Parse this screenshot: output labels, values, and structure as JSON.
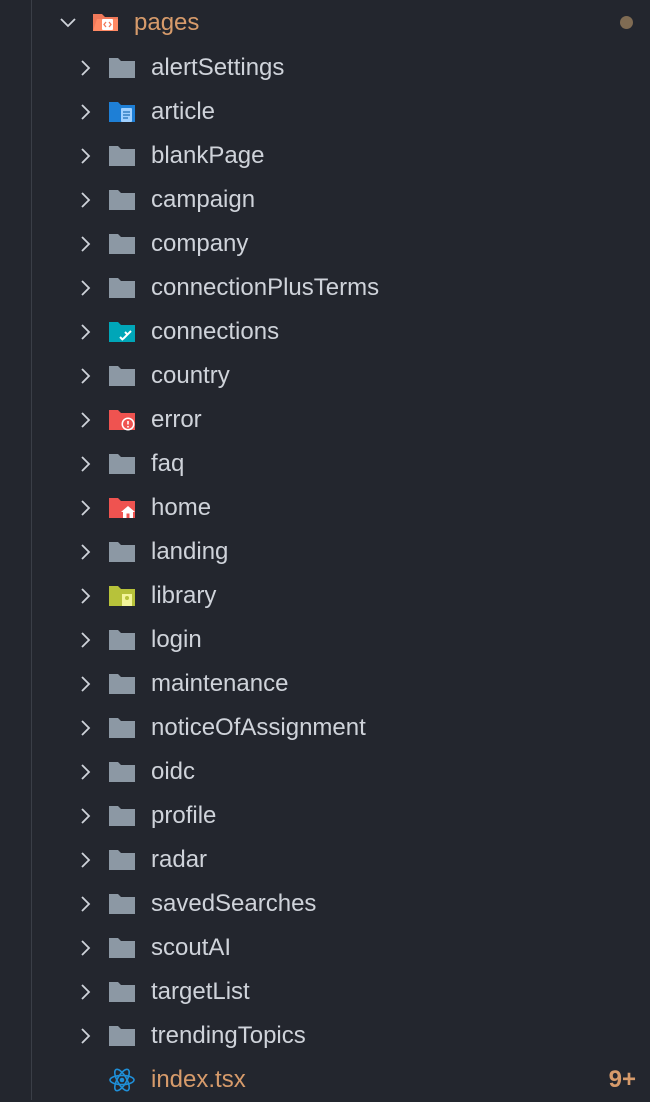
{
  "explorer": {
    "root": {
      "label": "pages",
      "icon": "folder-pages-open-icon",
      "expanded": true,
      "status": "modified-dot"
    },
    "folders": [
      {
        "label": "alertSettings",
        "icon": "folder-icon",
        "color": "#8c98a4"
      },
      {
        "label": "article",
        "icon": "folder-article-icon",
        "color": "#1e7fd6"
      },
      {
        "label": "blankPage",
        "icon": "folder-icon",
        "color": "#8c98a4"
      },
      {
        "label": "campaign",
        "icon": "folder-icon",
        "color": "#8c98a4"
      },
      {
        "label": "company",
        "icon": "folder-icon",
        "color": "#8c98a4"
      },
      {
        "label": "connectionPlusTerms",
        "icon": "folder-icon",
        "color": "#8c98a4"
      },
      {
        "label": "connections",
        "icon": "folder-connection-icon",
        "color": "#00a6b8"
      },
      {
        "label": "country",
        "icon": "folder-icon",
        "color": "#8c98a4"
      },
      {
        "label": "error",
        "icon": "folder-error-icon",
        "color": "#ef5350"
      },
      {
        "label": "faq",
        "icon": "folder-icon",
        "color": "#8c98a4"
      },
      {
        "label": "home",
        "icon": "folder-home-icon",
        "color": "#ef5350"
      },
      {
        "label": "landing",
        "icon": "folder-icon",
        "color": "#8c98a4"
      },
      {
        "label": "library",
        "icon": "folder-library-icon",
        "color": "#b7c23a"
      },
      {
        "label": "login",
        "icon": "folder-icon",
        "color": "#8c98a4"
      },
      {
        "label": "maintenance",
        "icon": "folder-icon",
        "color": "#8c98a4"
      },
      {
        "label": "noticeOfAssignment",
        "icon": "folder-icon",
        "color": "#8c98a4"
      },
      {
        "label": "oidc",
        "icon": "folder-icon",
        "color": "#8c98a4"
      },
      {
        "label": "profile",
        "icon": "folder-icon",
        "color": "#8c98a4"
      },
      {
        "label": "radar",
        "icon": "folder-icon",
        "color": "#8c98a4"
      },
      {
        "label": "savedSearches",
        "icon": "folder-icon",
        "color": "#8c98a4"
      },
      {
        "label": "scoutAI",
        "icon": "folder-icon",
        "color": "#8c98a4"
      },
      {
        "label": "targetList",
        "icon": "folder-icon",
        "color": "#8c98a4"
      },
      {
        "label": "trendingTopics",
        "icon": "folder-icon",
        "color": "#8c98a4"
      }
    ],
    "file": {
      "label": "index.tsx",
      "icon": "react-icon",
      "color": "#1f8fd8",
      "problems_badge": "9+"
    }
  }
}
